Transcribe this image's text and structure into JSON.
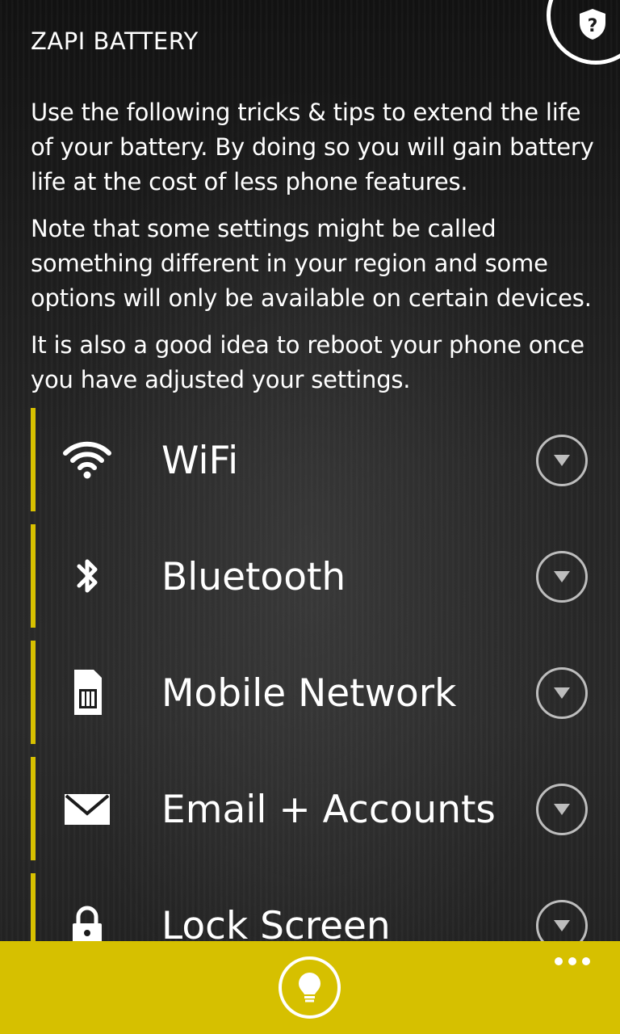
{
  "header": {
    "title": "ZAPI BATTERY",
    "help_icon": "shield-question-icon"
  },
  "intro": {
    "paragraphs": [
      "Use the following tricks & tips to extend the life of your battery.  By doing so you will gain battery life at the cost of less phone features.",
      "Note that some settings might be called something different in your region and some options will only be available on certain devices.",
      "It is also a good idea to reboot your phone once you have adjusted your settings."
    ]
  },
  "tips": [
    {
      "label": "WiFi",
      "icon": "wifi-icon"
    },
    {
      "label": "Bluetooth",
      "icon": "bluetooth-icon"
    },
    {
      "label": "Mobile Network",
      "icon": "sim-card-icon"
    },
    {
      "label": "Email + Accounts",
      "icon": "envelope-icon"
    },
    {
      "label": "Lock Screen",
      "icon": "padlock-icon"
    }
  ],
  "app_bar": {
    "main_icon": "lightbulb-icon",
    "more_icon": "ellipsis-icon"
  },
  "colors": {
    "accent": "#d7c000",
    "text": "#ffffff",
    "background": "#1b1b1b"
  }
}
